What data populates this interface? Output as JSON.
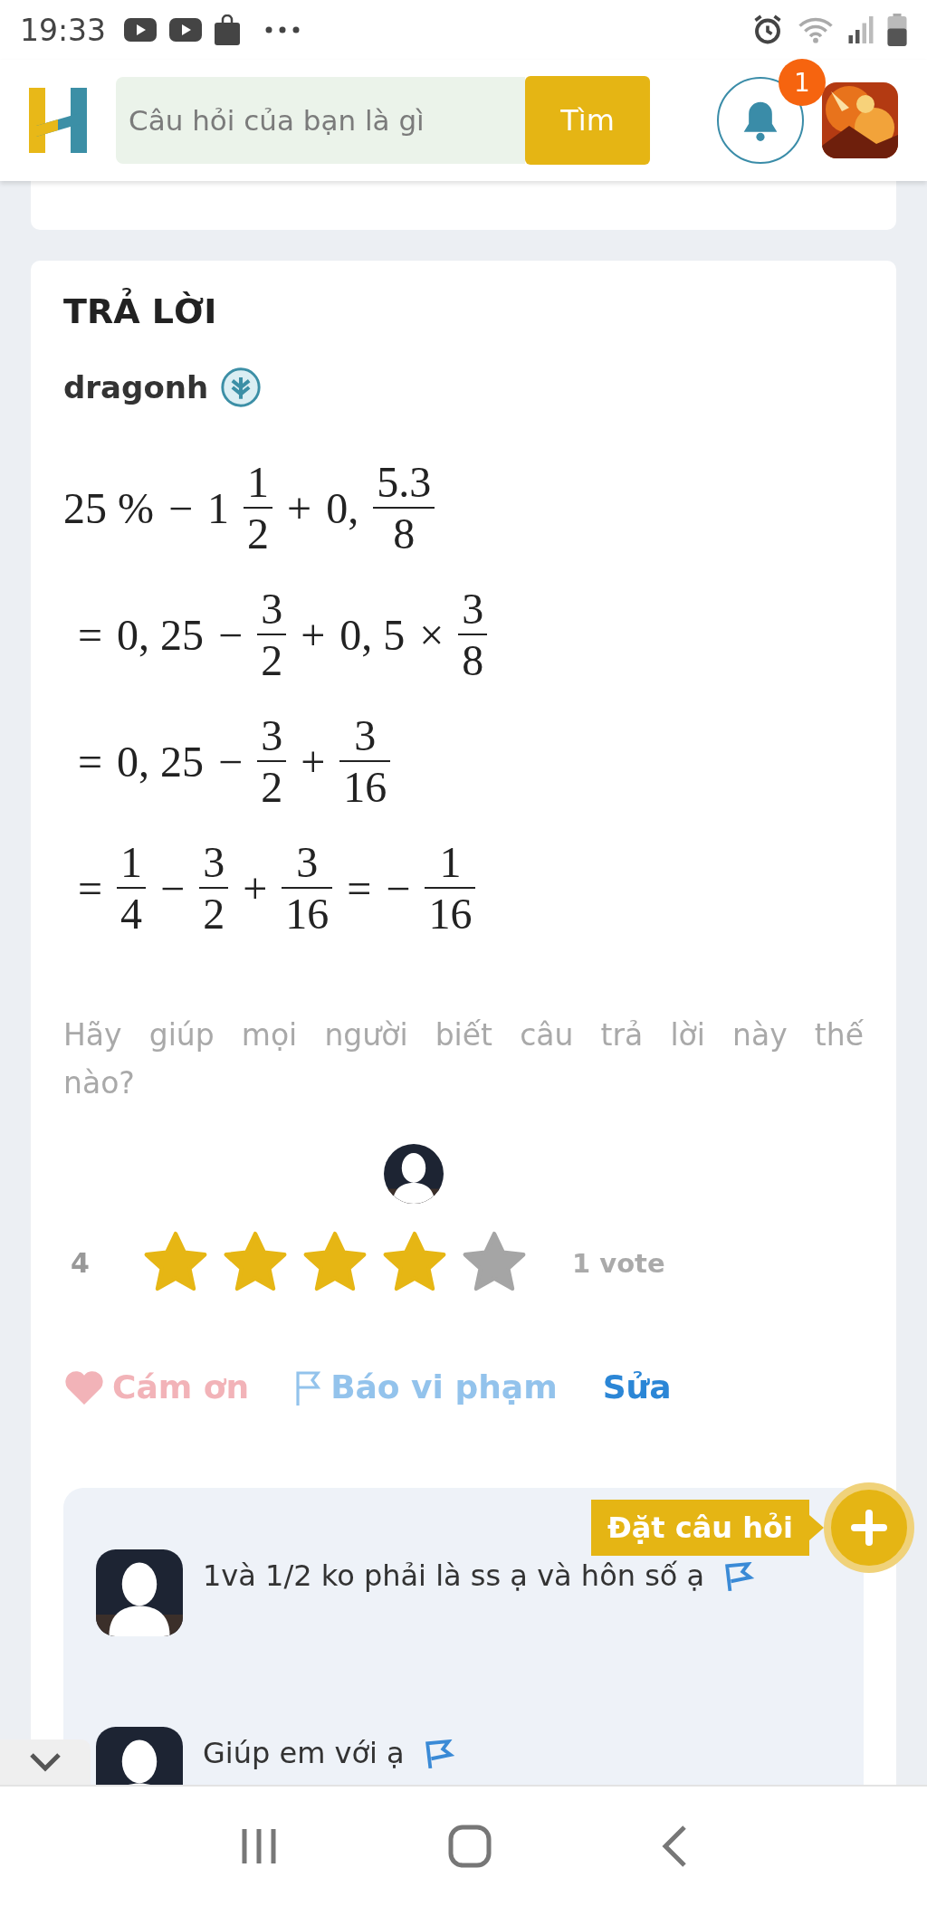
{
  "status_bar": {
    "time": "19:33"
  },
  "header": {
    "search": {
      "placeholder": "Câu hỏi của bạn là gì"
    },
    "search_button": "Tìm",
    "notifications": {
      "count": "1"
    }
  },
  "answer": {
    "title": "TRẢ LỜI",
    "author": "dragonh",
    "math_lines": [
      [
        {
          "kind": "text",
          "text": "25 %"
        },
        {
          "kind": "text",
          "text": "−"
        },
        {
          "kind": "text",
          "text": "1"
        },
        {
          "kind": "frac",
          "num": "1",
          "den": "2"
        },
        {
          "kind": "text",
          "text": "+"
        },
        {
          "kind": "text",
          "text": "0,"
        },
        {
          "kind": "frac",
          "num": "5.3",
          "den": "8"
        }
      ],
      [
        {
          "kind": "text",
          "text": "="
        },
        {
          "kind": "text",
          "text": "0, 25"
        },
        {
          "kind": "text",
          "text": "−"
        },
        {
          "kind": "frac",
          "num": "3",
          "den": "2"
        },
        {
          "kind": "text",
          "text": "+"
        },
        {
          "kind": "text",
          "text": "0, 5"
        },
        {
          "kind": "text",
          "text": "×"
        },
        {
          "kind": "frac",
          "num": "3",
          "den": "8"
        }
      ],
      [
        {
          "kind": "text",
          "text": "="
        },
        {
          "kind": "text",
          "text": "0, 25"
        },
        {
          "kind": "text",
          "text": "−"
        },
        {
          "kind": "frac",
          "num": "3",
          "den": "2"
        },
        {
          "kind": "text",
          "text": "+"
        },
        {
          "kind": "frac",
          "num": "3",
          "den": "16"
        }
      ],
      [
        {
          "kind": "text",
          "text": "="
        },
        {
          "kind": "frac",
          "num": "1",
          "den": "4"
        },
        {
          "kind": "text",
          "text": "−"
        },
        {
          "kind": "frac",
          "num": "3",
          "den": "2"
        },
        {
          "kind": "text",
          "text": "+"
        },
        {
          "kind": "frac",
          "num": "3",
          "den": "16"
        },
        {
          "kind": "text",
          "text": "="
        },
        {
          "kind": "text",
          "text": "−"
        },
        {
          "kind": "frac",
          "num": "1",
          "den": "16"
        }
      ]
    ],
    "prompt": "Hãy giúp mọi người biết câu trả lời này thế nào?",
    "rating": {
      "score": "4",
      "stars": 4,
      "votes": "1 vote"
    },
    "actions": [
      {
        "kind": "thank",
        "label": "Cám ơn"
      },
      {
        "kind": "report",
        "label": "Báo vi phạm"
      },
      {
        "kind": "edit",
        "label": "Sửa"
      }
    ]
  },
  "comments": [
    {
      "text": "1và 1/2 ko phải là ss ạ và hôn số ạ"
    },
    {
      "text": "Giúp em với ạ"
    }
  ],
  "ask_button": {
    "label": "Đặt câu hỏi"
  }
}
